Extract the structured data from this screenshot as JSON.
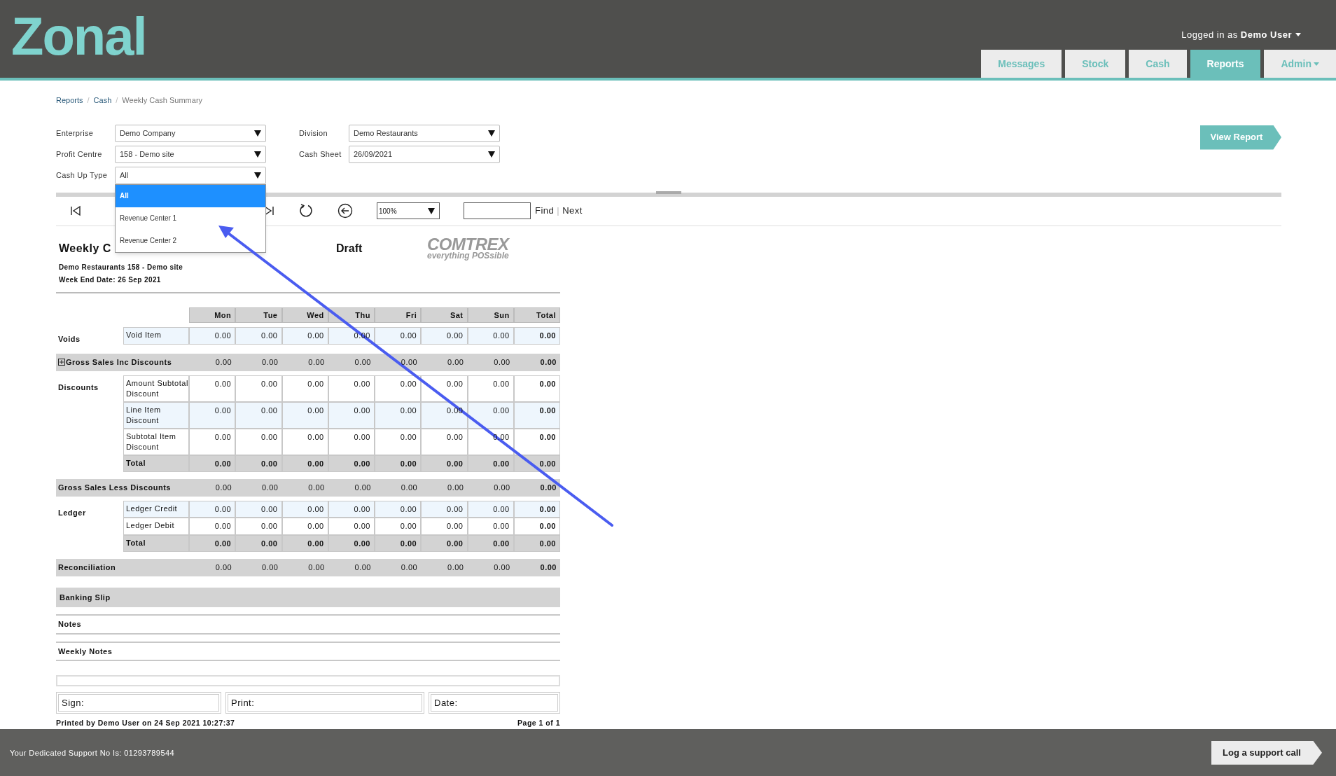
{
  "header": {
    "logo": "Zonal",
    "user_prefix": "Logged in as",
    "user_name": "Demo User",
    "tabs": [
      {
        "label": "Messages",
        "selected": false,
        "menu": false
      },
      {
        "label": "Stock",
        "selected": false,
        "menu": false
      },
      {
        "label": "Cash",
        "selected": false,
        "menu": false
      },
      {
        "label": "Reports",
        "selected": true,
        "menu": false
      },
      {
        "label": "Admin",
        "selected": false,
        "menu": true
      }
    ]
  },
  "breadcrumb": [
    {
      "label": "Reports",
      "separator": "/"
    },
    {
      "label": "Cash",
      "separator": "/"
    },
    {
      "label": "Weekly Cash Summary"
    }
  ],
  "filters": [
    {
      "label": "Enterprise",
      "value": "Demo Company"
    },
    {
      "label": "Division",
      "value": "Demo Restaurants"
    },
    {
      "label": "Profit Centre",
      "value": "158 - Demo site"
    },
    {
      "label": "Cash Sheet",
      "value": "26/09/2021"
    },
    {
      "label": "Cash Up Type",
      "value": "All",
      "open": true,
      "options": [
        {
          "label": "All",
          "selected": true
        },
        {
          "label": "Revenue Center 1",
          "selected": false
        },
        {
          "label": "Revenue Center 2",
          "selected": false
        }
      ]
    }
  ],
  "view_report": "View Report",
  "toolbar": {
    "zoom": "100%",
    "find": "Find",
    "separator": "|",
    "next": "Next"
  },
  "report": {
    "title": "Weekly C",
    "status": "Draft",
    "brand": "COMTREX",
    "brand_tagline": "everything POSsible",
    "subtitle": [
      "Demo Restaurants 158 - Demo site",
      "Week End Date: 26 Sep 2021"
    ],
    "columns": [
      "Mon",
      "Tue",
      "Wed",
      "Thu",
      "Fri",
      "Sat",
      "Sun",
      "Total"
    ],
    "sections": [
      {
        "kind": "group",
        "label": "Voids",
        "rows": [
          {
            "label": "Void Item",
            "shaded": true,
            "total": false,
            "values": [
              "0.00",
              "0.00",
              "0.00",
              "0.00",
              "0.00",
              "0.00",
              "0.00",
              "0.00"
            ]
          }
        ]
      },
      {
        "kind": "band",
        "label": "Gross Sales Inc Discounts",
        "expandable": true,
        "values": [
          "0.00",
          "0.00",
          "0.00",
          "0.00",
          "0.00",
          "0.00",
          "0.00",
          "0.00"
        ]
      },
      {
        "kind": "group",
        "label": "Discounts",
        "rows": [
          {
            "label": "Amount Subtotal Discount",
            "shaded": false,
            "total": false,
            "values": [
              "0.00",
              "0.00",
              "0.00",
              "0.00",
              "0.00",
              "0.00",
              "0.00",
              "0.00"
            ]
          },
          {
            "label": "Line Item Discount",
            "shaded": true,
            "total": false,
            "values": [
              "0.00",
              "0.00",
              "0.00",
              "0.00",
              "0.00",
              "0.00",
              "0.00",
              "0.00"
            ]
          },
          {
            "label": "Subtotal Item Discount",
            "shaded": false,
            "total": false,
            "values": [
              "0.00",
              "0.00",
              "0.00",
              "0.00",
              "0.00",
              "0.00",
              "0.00",
              "0.00"
            ]
          },
          {
            "label": "Total",
            "total": true,
            "values": [
              "0.00",
              "0.00",
              "0.00",
              "0.00",
              "0.00",
              "0.00",
              "0.00",
              "0.00"
            ]
          }
        ]
      },
      {
        "kind": "band",
        "label": "Gross Sales Less Discounts",
        "expandable": false,
        "values": [
          "0.00",
          "0.00",
          "0.00",
          "0.00",
          "0.00",
          "0.00",
          "0.00",
          "0.00"
        ]
      },
      {
        "kind": "group",
        "label": "Ledger",
        "rows": [
          {
            "label": "Ledger Credit",
            "shaded": true,
            "total": false,
            "values": [
              "0.00",
              "0.00",
              "0.00",
              "0.00",
              "0.00",
              "0.00",
              "0.00",
              "0.00"
            ]
          },
          {
            "label": "Ledger Debit",
            "shaded": false,
            "total": false,
            "values": [
              "0.00",
              "0.00",
              "0.00",
              "0.00",
              "0.00",
              "0.00",
              "0.00",
              "0.00"
            ]
          },
          {
            "label": "Total",
            "total": true,
            "values": [
              "0.00",
              "0.00",
              "0.00",
              "0.00",
              "0.00",
              "0.00",
              "0.00",
              "0.00"
            ]
          }
        ]
      },
      {
        "kind": "band",
        "label": "Reconciliation",
        "expandable": false,
        "values": [
          "0.00",
          "0.00",
          "0.00",
          "0.00",
          "0.00",
          "0.00",
          "0.00",
          "0.00"
        ]
      },
      {
        "kind": "heading",
        "label": "Banking Slip"
      },
      {
        "kind": "note",
        "label": "Notes"
      },
      {
        "kind": "note",
        "label": "Weekly Notes"
      }
    ],
    "signatures": [
      "Sign:",
      "Print:",
      "Date:"
    ],
    "printed_by": "Printed by Demo User on 24 Sep 2021 10:27:37",
    "page": "Page 1 of 1"
  },
  "footer": {
    "support": "Your Dedicated Support No Is: 01293789544",
    "button": "Log a support call"
  }
}
